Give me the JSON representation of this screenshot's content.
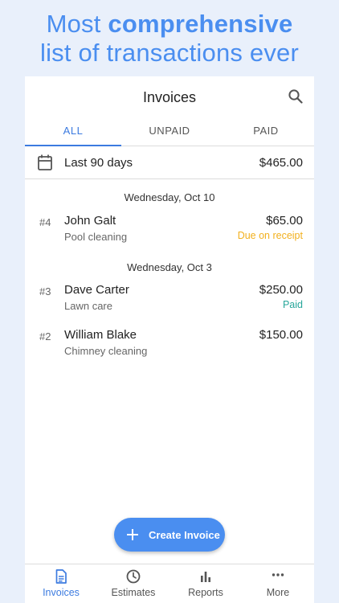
{
  "headline": {
    "line1_prefix": "Most ",
    "line1_bold": "comprehensive",
    "line2": "list of transactions ever"
  },
  "appbar": {
    "title": "Invoices",
    "search_icon": "search-icon"
  },
  "tabs": [
    {
      "label": "ALL",
      "active": true
    },
    {
      "label": "UNPAID",
      "active": false
    },
    {
      "label": "PAID",
      "active": false
    }
  ],
  "filter": {
    "label": "Last 90 days",
    "total": "$465.00",
    "icon": "calendar-icon"
  },
  "groups": [
    {
      "date": "Wednesday, Oct 10",
      "invoices": [
        {
          "number": "#4",
          "name": "John Galt",
          "description": "Pool cleaning",
          "amount": "$65.00",
          "status": "Due on receipt",
          "status_color": "#f2b01e"
        }
      ]
    },
    {
      "date": "Wednesday, Oct 3",
      "invoices": [
        {
          "number": "#3",
          "name": "Dave Carter",
          "description": "Lawn care",
          "amount": "$250.00",
          "status": "Paid",
          "status_color": "#26a69a"
        },
        {
          "number": "#2",
          "name": "William Blake",
          "description": "Chimney cleaning",
          "amount": "$150.00",
          "status": "",
          "status_color": ""
        }
      ]
    }
  ],
  "fab": {
    "label": "Create Invoice",
    "icon": "plus-icon"
  },
  "bottom_nav": [
    {
      "label": "Invoices",
      "icon": "document-icon",
      "active": true
    },
    {
      "label": "Estimates",
      "icon": "clock-icon",
      "active": false
    },
    {
      "label": "Reports",
      "icon": "bar-chart-icon",
      "active": false
    },
    {
      "label": "More",
      "icon": "more-dots-icon",
      "active": false
    }
  ],
  "colors": {
    "accent": "#3c7be0",
    "headline": "#4a8ef0",
    "background": "#e9f0fb"
  }
}
